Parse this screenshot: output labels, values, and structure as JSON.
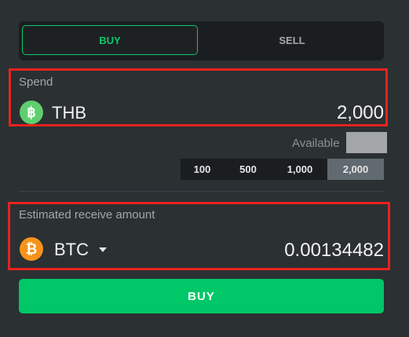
{
  "tabs": {
    "buy": "BUY",
    "sell": "SELL"
  },
  "spend": {
    "label": "Spend",
    "currency": "THB",
    "coin_symbol": "฿",
    "amount": "2,000"
  },
  "available": {
    "label": "Available"
  },
  "presets": [
    "100",
    "500",
    "1,000",
    "2,000"
  ],
  "selected_preset": "2,000",
  "receive": {
    "label": "Estimated receive amount",
    "currency": "BTC",
    "coin_symbol": "₿",
    "amount": "0.00134482"
  },
  "action": {
    "buy_label": "BUY"
  },
  "colors": {
    "accent": "#00c767",
    "highlight": "#e8221f",
    "thb_coin": "#5fce6e",
    "btc_coin": "#f7931a"
  }
}
